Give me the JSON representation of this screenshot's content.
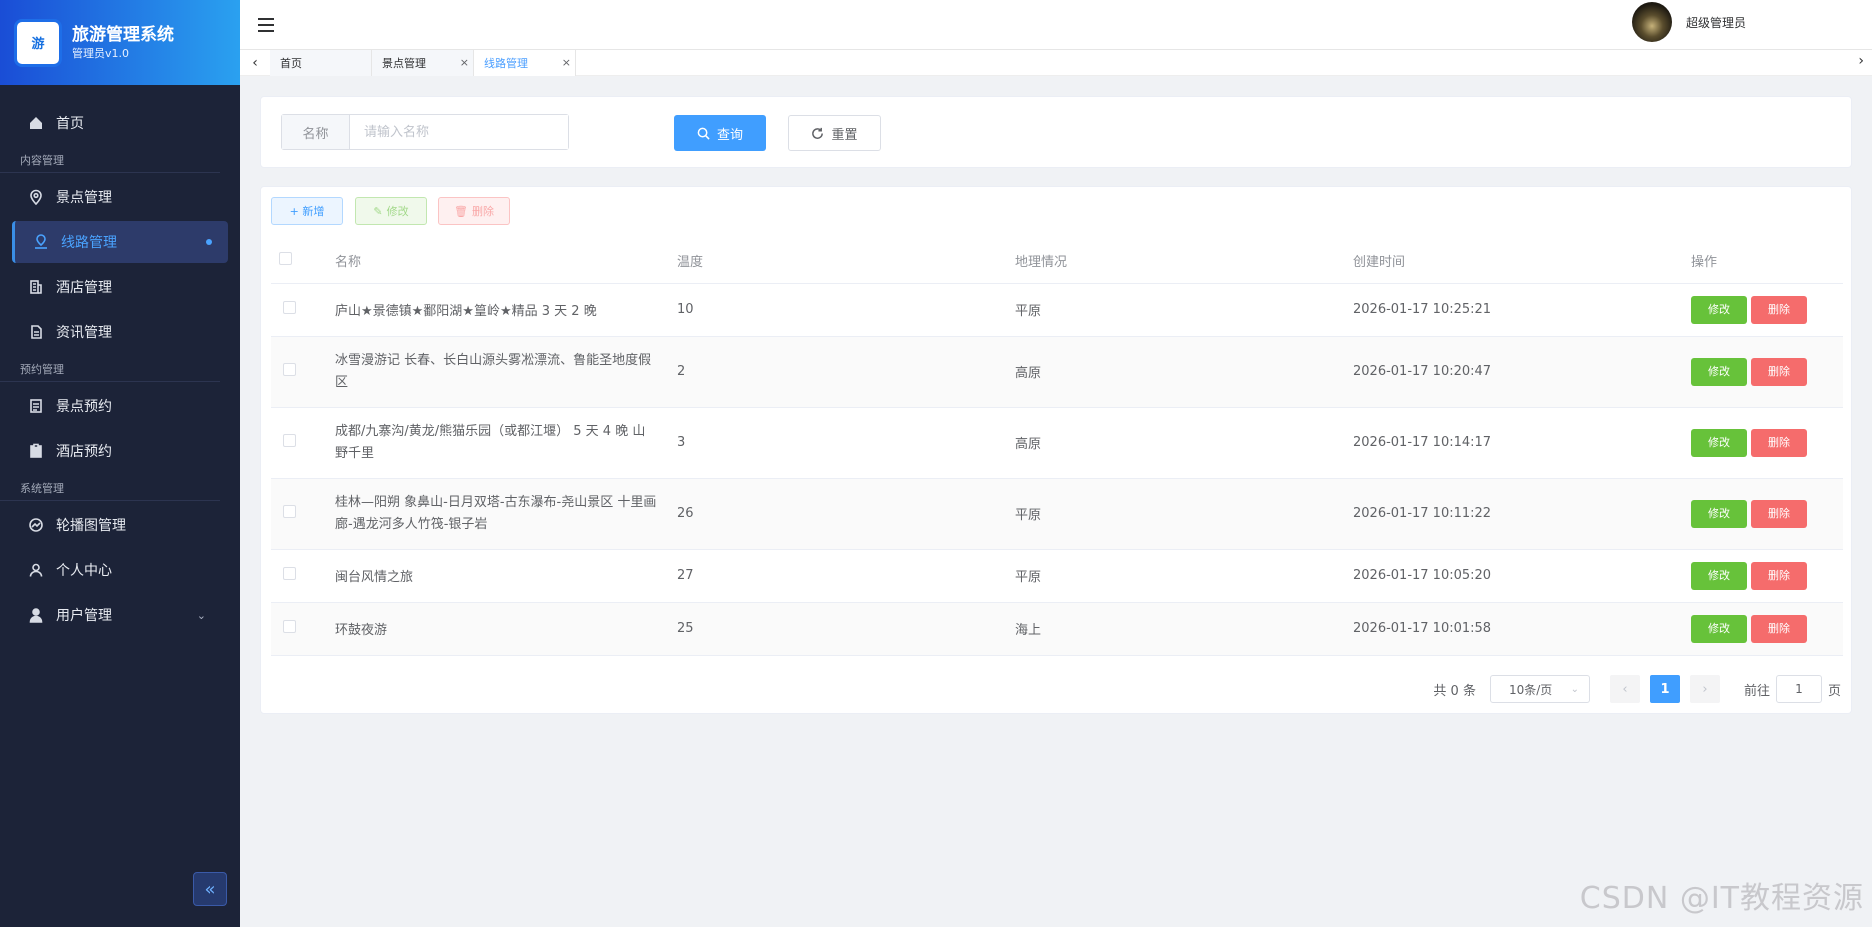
{
  "app": {
    "title": "旅游管理系统",
    "subtitle": "管理员v1.0",
    "logo_text": "游"
  },
  "sidebar": {
    "home": "首页",
    "group_content": "内容管理",
    "scenic": "景点管理",
    "route": "线路管理",
    "hotel": "酒店管理",
    "news": "资讯管理",
    "group_booking": "预约管理",
    "scenic_booking": "景点预约",
    "hotel_booking": "酒店预约",
    "group_system": "系统管理",
    "carousel": "轮播图管理",
    "profile": "个人中心",
    "users": "用户管理",
    "collapse_icon": "«"
  },
  "header": {
    "username": "超级管理员"
  },
  "tabs": [
    {
      "label": "首页"
    },
    {
      "label": "景点管理",
      "close": "×"
    },
    {
      "label": "线路管理",
      "close": "×"
    }
  ],
  "search": {
    "label": "名称",
    "placeholder": "请输入名称",
    "query_btn": "查询",
    "reset_btn": "重置"
  },
  "toolbar": {
    "add": "+ 新增",
    "edit": "修改",
    "delete": "删除"
  },
  "table": {
    "headers": [
      "名称",
      "温度",
      "地理情况",
      "创建时间",
      "操作"
    ],
    "rows": [
      {
        "name": "庐山★景德镇★鄱阳湖★篁岭★精品 3 天 2 晚",
        "temp": "10",
        "geo": "平原",
        "time": "2026-01-17 10:25:21"
      },
      {
        "name": "冰雪漫游记 长春、长白山源头雾凇漂流、鲁能圣地度假区",
        "temp": "2",
        "geo": "高原",
        "time": "2026-01-17 10:20:47"
      },
      {
        "name": "成都/九寨沟/黄龙/熊猫乐园（或都江堰） 5 天 4 晚 山野千里",
        "temp": "3",
        "geo": "高原",
        "time": "2026-01-17 10:14:17"
      },
      {
        "name": "桂林—阳朔 象鼻山-日月双塔-古东瀑布-尧山景区 十里画廊-遇龙河多人竹筏-银子岩",
        "temp": "26",
        "geo": "平原",
        "time": "2026-01-17 10:11:22"
      },
      {
        "name": "闽台风情之旅",
        "temp": "27",
        "geo": "平原",
        "time": "2026-01-17 10:05:20"
      },
      {
        "name": "环鼓夜游",
        "temp": "25",
        "geo": "海上",
        "time": "2026-01-17 10:01:58"
      }
    ],
    "op_edit": "修改",
    "op_delete": "删除"
  },
  "pagination": {
    "total": "共 0 条",
    "page_size": "10条/页",
    "current": "1",
    "goto_prefix": "前往",
    "goto_value": "1",
    "goto_suffix": "页"
  },
  "watermark": "CSDN @IT教程资源",
  "colors": {
    "primary": "#409eff",
    "sidebar_bg": "#1c2338",
    "success": "#67c23a",
    "danger": "#f56c6c"
  }
}
